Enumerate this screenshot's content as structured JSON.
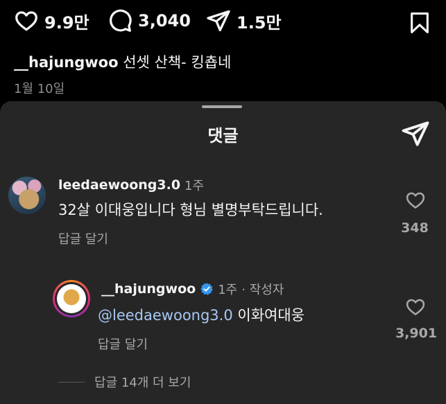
{
  "post": {
    "likes": "9.9만",
    "comments": "3,040",
    "shares": "1.5만",
    "caption_user": "__hajungwoo",
    "caption_text": "선셋 산책- 킹춉네",
    "date": "1월 10일"
  },
  "sheet": {
    "title": "댓글"
  },
  "comments": [
    {
      "username": "leedaewoong3.0",
      "time": "1주",
      "text": "32살 이대웅입니다 형님 별명부탁드립니다.",
      "reply_label": "답글 달기",
      "likes": "348"
    },
    {
      "username": "__hajungwoo",
      "time": "1주",
      "author_tag": "· 작성자",
      "mention": "@leedaewoong3.0",
      "text": " 이화여대웅",
      "reply_label": "답글 달기",
      "likes": "3,901"
    }
  ],
  "more_replies": "답글 14개 더 보기",
  "colors": {
    "background": "#000000",
    "sheet": "#262626",
    "mention": "#a7c7f3",
    "verified": "#3797f0"
  },
  "icons": {
    "like": "heart-icon",
    "comment": "comment-bubble-icon",
    "share": "paper-plane-icon",
    "save": "bookmark-icon",
    "verified": "verified-badge-icon"
  }
}
